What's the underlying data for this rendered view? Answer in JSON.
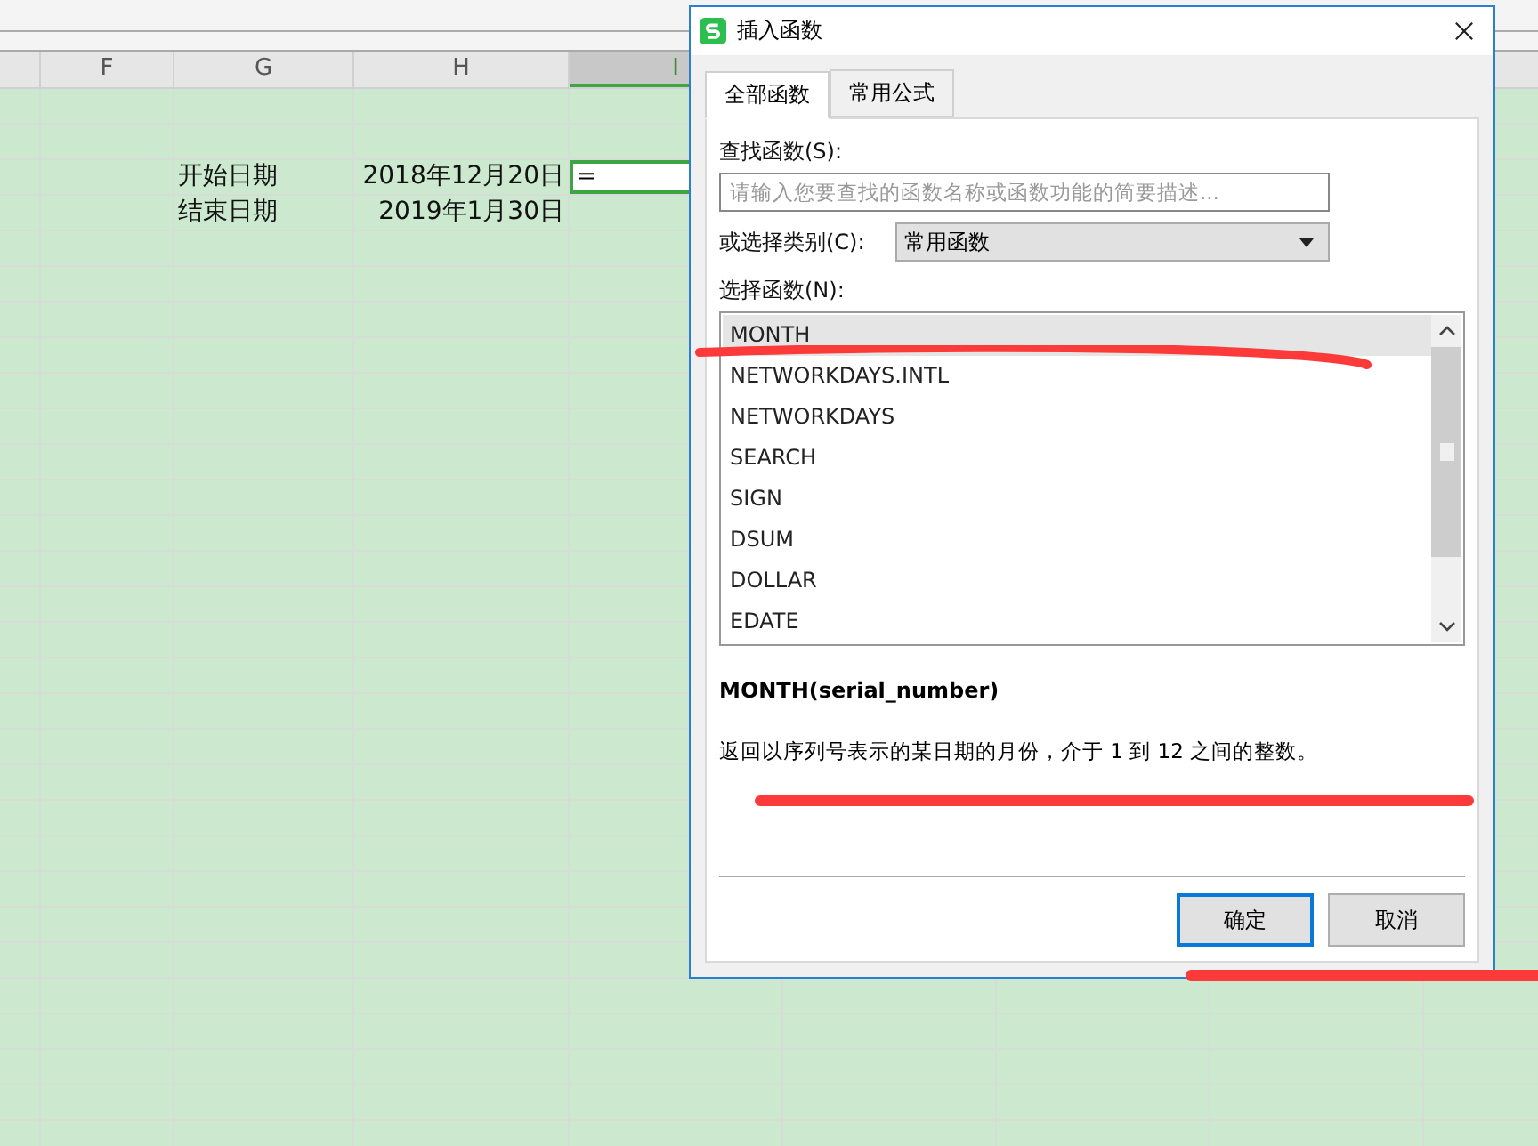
{
  "sheet": {
    "columns": [
      {
        "selected": false
      },
      {
        "label": "F",
        "selected": false
      },
      {
        "label": "G",
        "selected": false
      },
      {
        "label": "H",
        "selected": false
      },
      {
        "label": "I",
        "selected": true
      }
    ],
    "rows": [
      {
        "label": "开始日期",
        "value": "2018年12月20日",
        "input": "="
      },
      {
        "label": "结束日期",
        "value": "2019年1月30日"
      }
    ]
  },
  "dialog": {
    "title": "插入函数",
    "tabs": [
      {
        "label": "全部函数",
        "selected": true
      },
      {
        "label": "常用公式",
        "selected": false
      }
    ],
    "search": {
      "label": "查找函数(S):",
      "placeholder": "请输入您要查找的函数名称或函数功能的简要描述..."
    },
    "category": {
      "label": "或选择类别(C):",
      "value": "常用函数"
    },
    "functions": {
      "label": "选择函数(N):",
      "items": [
        {
          "name": "MONTH",
          "selected": true
        },
        {
          "name": "NETWORKDAYS.INTL",
          "selected": false
        },
        {
          "name": "NETWORKDAYS",
          "selected": false
        },
        {
          "name": "SEARCH",
          "selected": false
        },
        {
          "name": "SIGN",
          "selected": false
        },
        {
          "name": "DSUM",
          "selected": false
        },
        {
          "name": "DOLLAR",
          "selected": false
        },
        {
          "name": "EDATE",
          "selected": false
        }
      ]
    },
    "syntax": "MONTH(serial_number)",
    "description": "返回以序列号表示的某日期的月份，介于 1 到 12 之间的整数。",
    "buttons": [
      {
        "label": "确定",
        "default": true
      },
      {
        "label": "取消",
        "default": false
      }
    ]
  }
}
